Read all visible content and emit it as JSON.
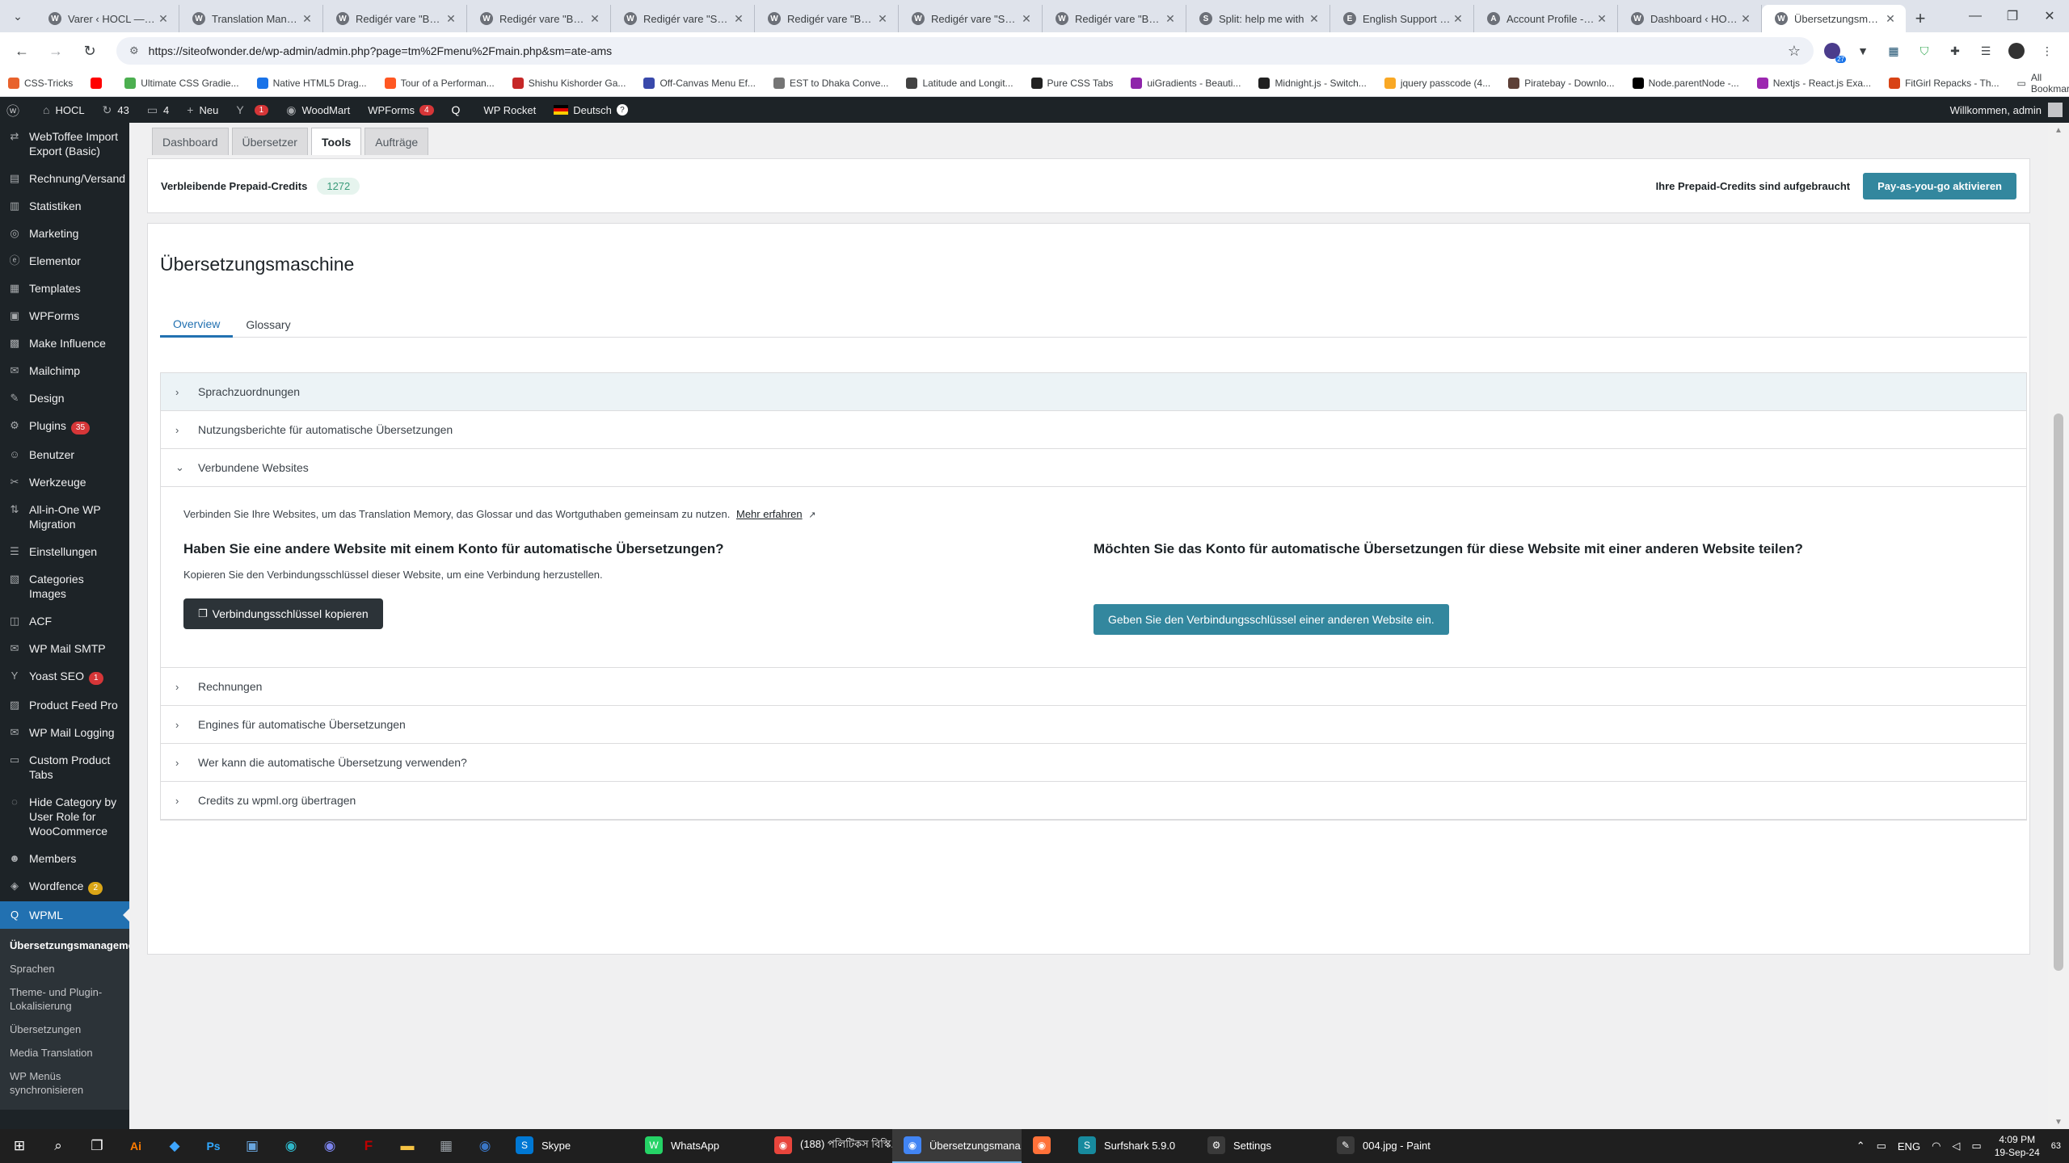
{
  "browser": {
    "tabs": [
      {
        "icon": "W",
        "label": "Varer ‹ HOCL — Wo",
        "active": false
      },
      {
        "icon": "W",
        "label": "Translation Manage",
        "active": false
      },
      {
        "icon": "W",
        "label": "Redigér vare \"Bug A",
        "active": false
      },
      {
        "icon": "W",
        "label": "Redigér vare \"Bug A",
        "active": false
      },
      {
        "icon": "W",
        "label": "Redigér vare \"Spray",
        "active": false
      },
      {
        "icon": "W",
        "label": "Redigér vare \"Bug A",
        "active": false
      },
      {
        "icon": "W",
        "label": "Redigér vare \"Spray",
        "active": false
      },
      {
        "icon": "W",
        "label": "Redigér vare \"Bug A",
        "active": false
      },
      {
        "icon": "S",
        "label": "Split: help me with",
        "active": false
      },
      {
        "icon": "E",
        "label": "English Support - W",
        "active": false
      },
      {
        "icon": "A",
        "label": "Account Profile - W",
        "active": false
      },
      {
        "icon": "W",
        "label": "Dashboard ‹ HOCL",
        "active": false
      },
      {
        "icon": "W",
        "label": "Übersetzungsmana",
        "active": true
      }
    ],
    "url": "https://siteofwonder.de/wp-admin/admin.php?page=tm%2Fmenu%2Fmain.php&sm=ate-ams",
    "extension_badge": "27",
    "bookmarks": [
      {
        "label": "CSS-Tricks",
        "color": "#e8622c"
      },
      {
        "label": "",
        "color": "#ff0000"
      },
      {
        "label": "Ultimate CSS Gradie...",
        "color": "#4caf50"
      },
      {
        "label": "Native HTML5 Drag...",
        "color": "#1a73e8"
      },
      {
        "label": "Tour of a Performan...",
        "color": "#ff5722"
      },
      {
        "label": "Shishu Kishorder Ga...",
        "color": "#c62828"
      },
      {
        "label": "Off-Canvas Menu Ef...",
        "color": "#3949ab"
      },
      {
        "label": "EST to Dhaka Conve...",
        "color": "#757575"
      },
      {
        "label": "Latitude and Longit...",
        "color": "#424242"
      },
      {
        "label": "Pure CSS Tabs",
        "color": "#212121"
      },
      {
        "label": "uiGradients - Beauti...",
        "color": "#8e24aa"
      },
      {
        "label": "Midnight.js - Switch...",
        "color": "#212121"
      },
      {
        "label": "jquery passcode (4...",
        "color": "#f9a825"
      },
      {
        "label": "Piratebay - Downlo...",
        "color": "#5d4037"
      },
      {
        "label": "Node.parentNode -...",
        "color": "#000000"
      },
      {
        "label": "Nextjs - React.js Exa...",
        "color": "#9c27b0"
      },
      {
        "label": "FitGirl Repacks - Th...",
        "color": "#d84315"
      }
    ],
    "all_bookmarks": "All Bookmarks"
  },
  "adminbar": {
    "site": "HOCL",
    "updates": "43",
    "comments": "4",
    "new": "Neu",
    "yoast_count": "1",
    "woodmart": "WoodMart",
    "wpforms": "WPForms",
    "wpforms_count": "4",
    "wprocket": "WP Rocket",
    "language": "Deutsch",
    "welcome": "Willkommen, admin"
  },
  "sidebar": {
    "items": [
      {
        "icon": "⇄",
        "label": "WebToffee Import Export (Basic)"
      },
      {
        "icon": "▤",
        "label": "Rechnung/Versand"
      },
      {
        "icon": "▥",
        "label": "Statistiken"
      },
      {
        "icon": "◎",
        "label": "Marketing"
      },
      {
        "icon": "ⓔ",
        "label": "Elementor"
      },
      {
        "icon": "▦",
        "label": "Templates"
      },
      {
        "icon": "▣",
        "label": "WPForms"
      },
      {
        "icon": "▩",
        "label": "Make Influence"
      },
      {
        "icon": "✉",
        "label": "Mailchimp"
      },
      {
        "icon": "✎",
        "label": "Design"
      },
      {
        "icon": "⚙",
        "label": "Plugins",
        "badge": "35"
      },
      {
        "icon": "☺",
        "label": "Benutzer"
      },
      {
        "icon": "✂",
        "label": "Werkzeuge"
      },
      {
        "icon": "⇅",
        "label": "All-in-One WP Migration"
      },
      {
        "icon": "☰",
        "label": "Einstellungen"
      },
      {
        "icon": "▧",
        "label": "Categories Images"
      },
      {
        "icon": "◫",
        "label": "ACF"
      },
      {
        "icon": "✉",
        "label": "WP Mail SMTP"
      },
      {
        "icon": "Y",
        "label": "Yoast SEO",
        "badge": "1"
      },
      {
        "icon": "▨",
        "label": "Product Feed Pro"
      },
      {
        "icon": "✉",
        "label": "WP Mail Logging"
      },
      {
        "icon": "▭",
        "label": "Custom Product Tabs"
      },
      {
        "icon": "◌",
        "label": "Hide Category by User Role for WooCommerce"
      },
      {
        "icon": "☻",
        "label": "Members"
      },
      {
        "icon": "◈",
        "label": "Wordfence",
        "badge": "2"
      }
    ],
    "current": {
      "icon": "Q",
      "label": "WPML"
    },
    "subitems": [
      {
        "label": "Übersetzungsmanagement",
        "current": true
      },
      {
        "label": "Sprachen",
        "current": false
      },
      {
        "label": "Theme- und Plugin-Lokalisierung",
        "current": false
      },
      {
        "label": "Übersetzungen",
        "current": false
      },
      {
        "label": "Media Translation",
        "current": false
      },
      {
        "label": "WP Menüs synchronisieren",
        "current": false
      }
    ]
  },
  "main": {
    "tabs": [
      "Dashboard",
      "Übersetzer",
      "Tools",
      "Aufträge"
    ],
    "active_tab": "Tools",
    "credits_label": "Verbleibende Prepaid-Credits",
    "credits_value": "1272",
    "credits_message": "Ihre Prepaid-Credits sind aufgebraucht",
    "payg_button": "Pay-as-you-go aktivieren",
    "engine_title": "Übersetzungsmaschine",
    "subtabs": [
      "Overview",
      "Glossary"
    ],
    "accordion_top": [
      {
        "label": "Sprachzuordnungen"
      },
      {
        "label": "Nutzungsberichte für automatische Übersetzungen"
      }
    ],
    "accordion_open": {
      "label": "Verbundene Websites",
      "intro": "Verbinden Sie Ihre Websites, um das Translation Memory, das Glossar und das Wortguthaben gemeinsam zu nutzen.",
      "learn_more": "Mehr erfahren",
      "left_title": "Haben Sie eine andere Website mit einem Konto für automatische Übersetzungen?",
      "left_text": "Kopieren Sie den Verbindungsschlüssel dieser Website, um eine Verbindung herzustellen.",
      "left_button": "Verbindungsschlüssel kopieren",
      "right_title": "Möchten Sie das Konto für automatische Übersetzungen für diese Website mit einer anderen Website teilen?",
      "right_button": "Geben Sie den Verbindungsschlüssel einer anderen Website ein."
    },
    "accordion_bottom": [
      {
        "label": "Rechnungen"
      },
      {
        "label": "Engines für automatische Übersetzungen"
      },
      {
        "label": "Wer kann die automatische Übersetzung verwenden?"
      },
      {
        "label": "Credits zu wpml.org übertragen"
      }
    ]
  },
  "taskbar": {
    "apps": [
      {
        "label": "Skype",
        "icon": "S",
        "color": "#0078d4",
        "active": false
      },
      {
        "label": "WhatsApp",
        "icon": "W",
        "color": "#25d366",
        "active": false
      },
      {
        "label": "(188) পলিটিকস বিস্কি...",
        "icon": "◉",
        "color": "#e8453c",
        "active": false
      },
      {
        "label": "Übersetzungsmana...",
        "icon": "◉",
        "color": "#4285f4",
        "active": true
      },
      {
        "label": "",
        "icon": "◉",
        "color": "#ff7139",
        "active": false
      },
      {
        "label": "Surfshark 5.9.0",
        "icon": "S",
        "color": "#178a9e",
        "active": false
      },
      {
        "label": "Settings",
        "icon": "⚙",
        "color": "#3a3a3a",
        "active": false
      },
      {
        "label": "004.jpg - Paint",
        "icon": "✎",
        "color": "#3a3a3a",
        "active": false
      }
    ],
    "lang": "ENG",
    "time": "4:09 PM",
    "date": "19-Sep-24",
    "notif": "63"
  }
}
